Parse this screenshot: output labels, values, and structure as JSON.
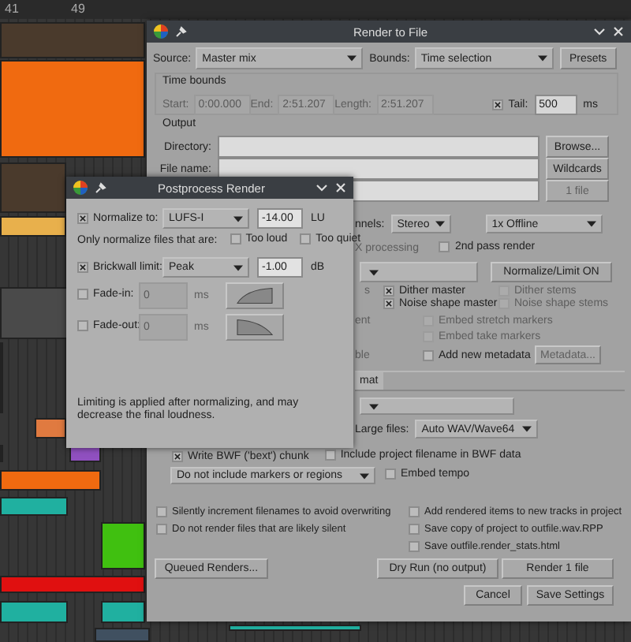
{
  "arrange": {
    "ruler": [
      "41",
      "49"
    ]
  },
  "render": {
    "title": "Render to File",
    "source_label": "Source:",
    "source": "Master mix",
    "bounds_label": "Bounds:",
    "bounds": "Time selection",
    "presets": "Presets",
    "time_bounds": {
      "title": "Time bounds",
      "disabled": true,
      "fields": [
        {
          "label": "Start:",
          "value": "0:00.000"
        },
        {
          "label": "End:",
          "value": "2:51.207"
        },
        {
          "label": "Length:",
          "value": "2:51.207"
        }
      ],
      "tail_checked": true,
      "tail_label": "Tail:",
      "tail_value": "500",
      "tail_unit": "ms"
    },
    "output": {
      "title": "Output",
      "rows": [
        {
          "label": "Directory:",
          "button": "Browse...",
          "disabled": false
        },
        {
          "label": "File name:",
          "button": "Wildcards",
          "disabled": false
        },
        {
          "button": "1 file",
          "disabled": true
        }
      ]
    },
    "channels_label": "nnels:",
    "channels": "Stereo",
    "speed": "1x Offline",
    "fx_label": "X processing",
    "second_pass": {
      "label": "2nd pass render",
      "checked": false
    },
    "normalize_button": "Normalize/Limit ON",
    "dither_label": "s",
    "checks": [
      {
        "label": "Dither master",
        "checked": true,
        "disabled": false
      },
      {
        "label": "Dither stems",
        "checked": false,
        "disabled": true
      },
      {
        "label": "Noise shape master",
        "checked": true,
        "disabled": false
      },
      {
        "label": "Noise shape stems",
        "checked": false,
        "disabled": true
      }
    ],
    "embed_label": "ent",
    "embeds": [
      {
        "label": "Embed stretch markers",
        "checked": false,
        "disabled": true
      },
      {
        "label": "Embed take markers",
        "checked": false,
        "disabled": true
      }
    ],
    "metadata_label": "ble",
    "add_metadata": {
      "label": "Add new metadata",
      "checked": false
    },
    "metadata_button": {
      "label": "Metadata...",
      "disabled": true
    },
    "format_tab": "mat",
    "large_files_label": "Large files:",
    "large_files": "Auto WAV/Wave64",
    "bwf": [
      {
        "label": "Write BWF ('bext') chunk",
        "checked": true
      },
      {
        "label": "Include project filename in BWF data",
        "checked": false
      }
    ],
    "markers": "Do not include markers or regions",
    "embed_tempo": {
      "label": "Embed tempo",
      "checked": false
    },
    "options_left": [
      {
        "label": "Silently increment filenames to avoid overwriting",
        "checked": false
      },
      {
        "label": "Do not render files that are likely silent",
        "checked": false
      }
    ],
    "options_right": [
      {
        "label": "Add rendered items to new tracks in project",
        "checked": false
      },
      {
        "label": "Save copy of project to outfile.wav.RPP",
        "checked": false
      },
      {
        "label": "Save outfile.render_stats.html",
        "checked": false
      }
    ],
    "buttons": {
      "queued": "Queued Renders...",
      "dry_run": "Dry Run (no output)",
      "render": "Render 1 file",
      "cancel": "Cancel",
      "save": "Save Settings"
    }
  },
  "postprocess": {
    "title": "Postprocess Render",
    "normalize": {
      "checked": true,
      "label": "Normalize to:",
      "mode": "LUFS-I",
      "value": "-14.00",
      "unit": "LU"
    },
    "only_label": "Only normalize files that are:",
    "only": [
      {
        "label": "Too loud",
        "checked": false
      },
      {
        "label": "Too quiet",
        "checked": false
      }
    ],
    "limit": {
      "checked": true,
      "label": "Brickwall limit:",
      "mode": "Peak",
      "value": "-1.00",
      "unit": "dB"
    },
    "fades": [
      {
        "kind": "in",
        "label": "Fade-in:",
        "checked": false,
        "value": "0",
        "unit": "ms"
      },
      {
        "kind": "out",
        "label": "Fade-out:",
        "checked": false,
        "value": "0",
        "unit": "ms"
      }
    ],
    "note": "Limiting is applied after normalizing, and may decrease the final loudness."
  }
}
